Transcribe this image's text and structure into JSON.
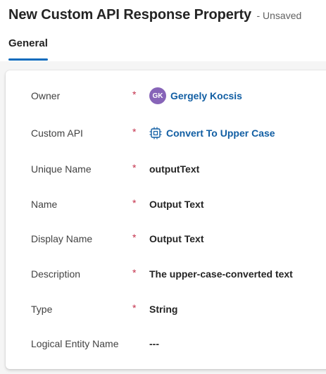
{
  "header": {
    "title": "New Custom API Response Property",
    "status": "- Unsaved"
  },
  "tabs": [
    {
      "label": "General",
      "active": true
    }
  ],
  "form": {
    "fields": [
      {
        "label": "Owner",
        "required": "*",
        "value": "Gergely Kocsis",
        "avatar_initials": "GK",
        "type": "user-lookup"
      },
      {
        "label": "Custom API",
        "required": "*",
        "value": "Convert To Upper Case",
        "icon": "custom-api-icon",
        "type": "lookup"
      },
      {
        "label": "Unique Name",
        "required": "*",
        "value": "outputText"
      },
      {
        "label": "Name",
        "required": "*",
        "value": "Output Text"
      },
      {
        "label": "Display Name",
        "required": "*",
        "value": "Output Text"
      },
      {
        "label": "Description",
        "required": "*",
        "value": "The upper-case-converted text"
      },
      {
        "label": "Type",
        "required": "*",
        "value": "String"
      },
      {
        "label": "Logical Entity Name",
        "required": "",
        "value": "---"
      }
    ]
  },
  "colors": {
    "accent": "#0f6cbd",
    "link": "#115ea3",
    "required": "#c4314b",
    "avatar": "#8764b8"
  }
}
